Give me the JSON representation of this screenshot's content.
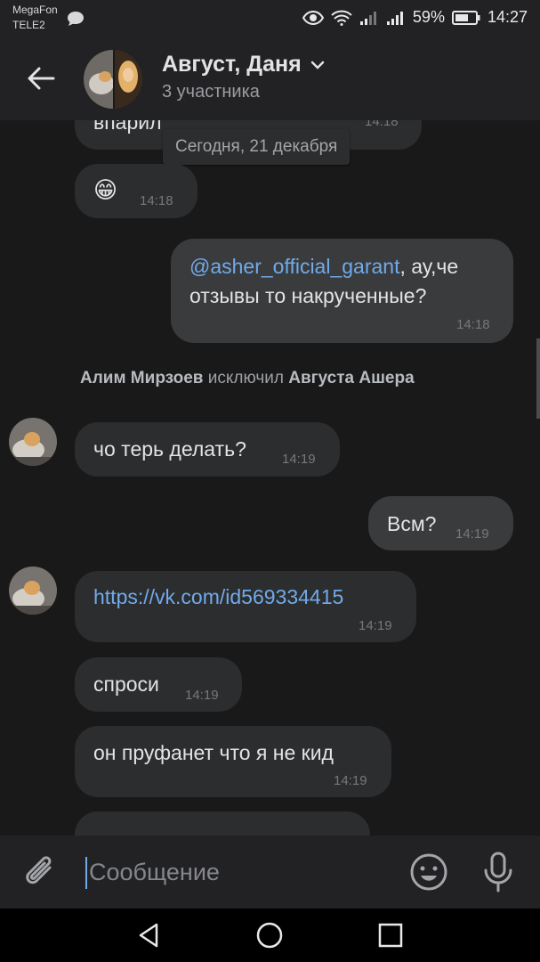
{
  "status_bar": {
    "carrier_1": "MegaFon",
    "carrier_2": "TELE2",
    "battery": "59%",
    "time": "14:27"
  },
  "header": {
    "title": "Август, Даня",
    "subtitle": "3 участника"
  },
  "chat": {
    "date_chip": "Сегодня, 21 декабря",
    "messages": [
      {
        "text": "впарил",
        "time": "14:18"
      },
      {
        "text": "😁",
        "time": "14:18"
      },
      {
        "mention": "@asher_official_garant",
        "text_after": ", ау,че",
        "text_line2": "отзывы то накрученные?",
        "time": "14:18"
      },
      {
        "text": "чо терь делать?",
        "time": "14:19"
      },
      {
        "text": "Всм?",
        "time": "14:19"
      },
      {
        "text": "https://vk.com/id569334415",
        "time": "14:19"
      },
      {
        "text": "спроси",
        "time": "14:19"
      },
      {
        "text": "он пруфанет что я не кид",
        "time": "14:19"
      }
    ],
    "service": {
      "actor": "Алим Мирзоев",
      "action": " исключил ",
      "target": "Августа Ашера"
    }
  },
  "composer": {
    "placeholder": "Сообщение"
  },
  "colors": {
    "background": "#19191a",
    "bubble": "#2c2d2e",
    "link": "#71aaeb"
  }
}
